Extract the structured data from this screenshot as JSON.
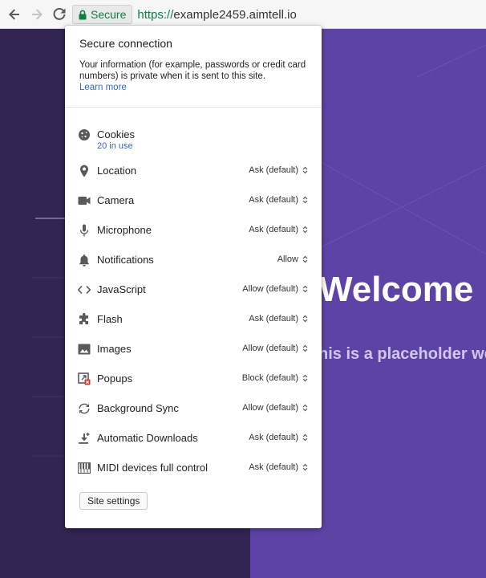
{
  "toolbar": {
    "secure_label": "Secure",
    "url_scheme": "https://",
    "url_host": "example2459.aimtell.io"
  },
  "page": {
    "hero_title": "Welcome",
    "hero_subtitle": "his is a placeholder we"
  },
  "popup": {
    "title": "Secure connection",
    "description": "Your information (for example, passwords or credit card numbers) is private when it is sent to this site.",
    "learn_more": "Learn more",
    "cookies": {
      "label": "Cookies",
      "sub": "20 in use"
    },
    "permissions": [
      {
        "label": "Location",
        "value": "Ask (default)",
        "icon": "location-pin-icon"
      },
      {
        "label": "Camera",
        "value": "Ask (default)",
        "icon": "camera-icon"
      },
      {
        "label": "Microphone",
        "value": "Ask (default)",
        "icon": "microphone-icon"
      },
      {
        "label": "Notifications",
        "value": "Allow",
        "icon": "bell-icon"
      },
      {
        "label": "JavaScript",
        "value": "Allow (default)",
        "icon": "code-brackets-icon"
      },
      {
        "label": "Flash",
        "value": "Ask (default)",
        "icon": "puzzle-icon"
      },
      {
        "label": "Images",
        "value": "Allow (default)",
        "icon": "image-icon"
      },
      {
        "label": "Popups",
        "value": "Block (default)",
        "icon": "popup-blocked-icon"
      },
      {
        "label": "Background Sync",
        "value": "Allow (default)",
        "icon": "sync-icon"
      },
      {
        "label": "Automatic Downloads",
        "value": "Ask (default)",
        "icon": "download-icon"
      },
      {
        "label": "MIDI devices full control",
        "value": "Ask (default)",
        "icon": "piano-keys-icon"
      }
    ],
    "site_settings_label": "Site settings"
  },
  "colors": {
    "secure_green": "#0b8043",
    "link_blue": "#3367d6",
    "page_left": "#322553",
    "page_right": "#5e43a7"
  }
}
